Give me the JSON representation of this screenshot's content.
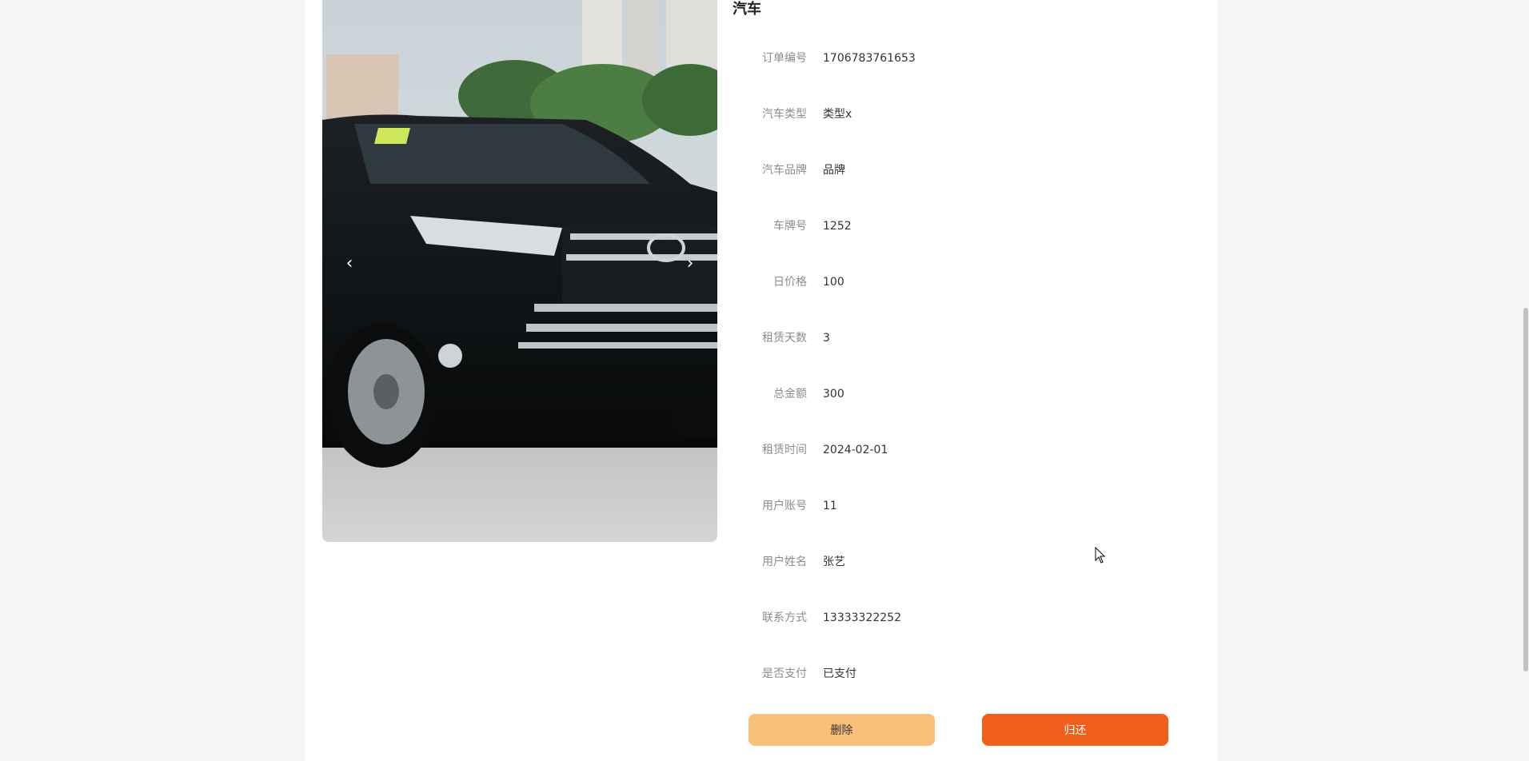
{
  "detail": {
    "title": "汽车",
    "fields": [
      {
        "label": "订单编号",
        "value": "1706783761653"
      },
      {
        "label": "汽车类型",
        "value": "类型x"
      },
      {
        "label": "汽车品牌",
        "value": "品牌"
      },
      {
        "label": "车牌号",
        "value": "1252"
      },
      {
        "label": "日价格",
        "value": "100"
      },
      {
        "label": "租赁天数",
        "value": "3"
      },
      {
        "label": "总金额",
        "value": "300"
      },
      {
        "label": "租赁时间",
        "value": "2024-02-01"
      },
      {
        "label": "用户账号",
        "value": "11"
      },
      {
        "label": "用户姓名",
        "value": "张艺"
      },
      {
        "label": "联系方式",
        "value": "13333322252"
      },
      {
        "label": "是否支付",
        "value": "已支付"
      }
    ]
  },
  "carousel": {
    "prev_glyph": "‹",
    "next_glyph": "›"
  },
  "actions": {
    "delete_label": "删除",
    "return_label": "归还"
  },
  "colors": {
    "delete_button": "#f8c078",
    "return_button": "#f05f19",
    "background": "#f5f5f5"
  }
}
